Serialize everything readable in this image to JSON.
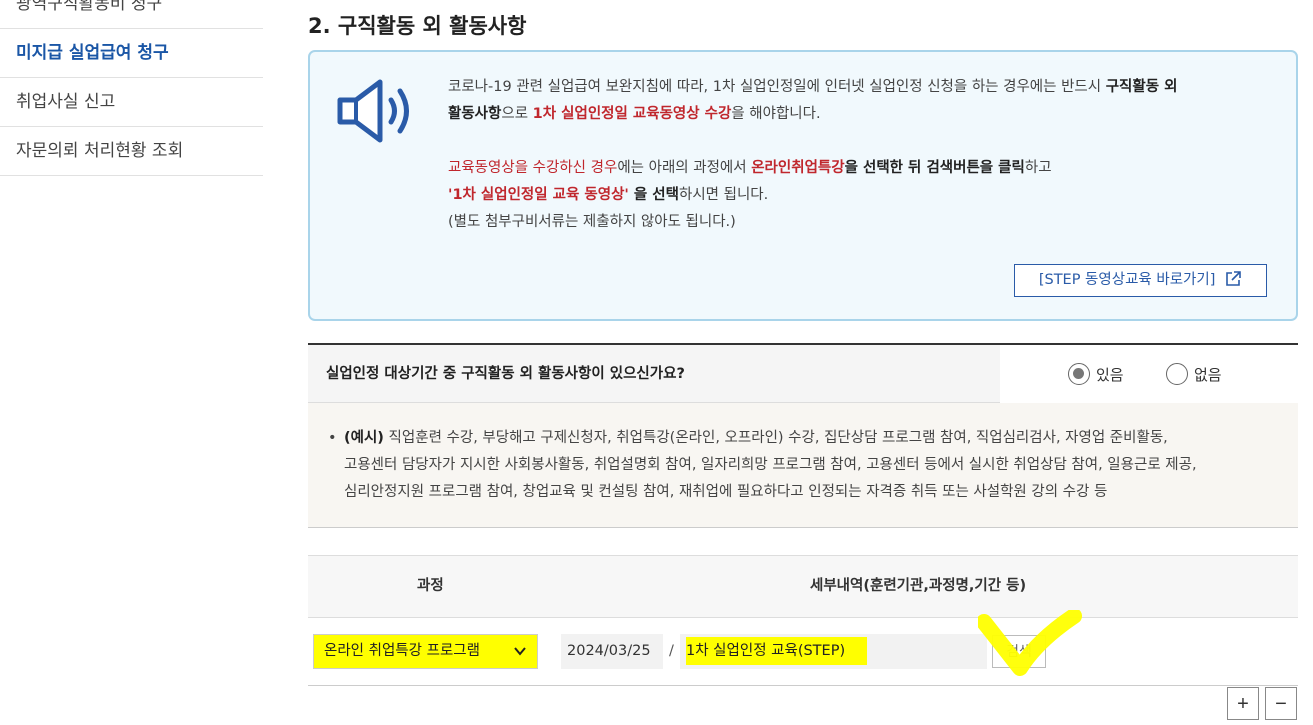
{
  "sidebar": {
    "items": [
      {
        "label": "광역구직활동비 청구"
      },
      {
        "label": "미지급 실업급여 청구"
      },
      {
        "label": "취업사실 신고"
      },
      {
        "label": "자문의뢰 처리현황 조회"
      }
    ]
  },
  "section": {
    "title": "2. 구직활동 외 활동사항"
  },
  "notice": {
    "icon": "speaker-icon",
    "line1_a": "코로나-19 관련 실업급여 보완지침에 따라, 1차 실업인정일에 인터넷 실업인정 신청을 하는 경우에는 반드시 ",
    "line1_b": "구직활동 외",
    "line2_a": "활동사항",
    "line2_b": "으로 ",
    "line2_c": "1차 실업인정일 교육동영상 수강",
    "line2_d": "을 해야합니다.",
    "line3_a": "교육동영상을 수강하신 경우",
    "line3_b": "에는 아래의 과정에서 ",
    "line3_c": "온라인취업특강",
    "line3_d": "을 선택한 뒤 검색버튼을 클릭",
    "line3_e": "하고",
    "line4_a": "'1차 실업인정일 교육 동영상'",
    "line4_b": " 을 선택",
    "line4_c": "하시면 됩니다.",
    "line5": "(별도 첨부구비서류는 제출하지 않아도 됩니다.)",
    "link_label": "[STEP 동영상교육 바로가기]"
  },
  "question": {
    "label": "실업인정 대상기간 중 구직활동 외 활동사항이 있으신가요?",
    "options": [
      {
        "label": "있음",
        "selected": true
      },
      {
        "label": "없음",
        "selected": false
      }
    ]
  },
  "examples": {
    "prefix": "(예시)",
    "line1": " 직업훈련 수강, 부당해고 구제신청자, 취업특강(온라인, 오프라인) 수강, 집단상담 프로그램 참여, 직업심리검사, 자영업 준비활동,",
    "line2": "고용센터 담당자가 지시한 사회봉사활동, 취업설명회 참여, 일자리희망 프로그램 참여, 고용센터 등에서 실시한 취업상담 참여, 일용근로 제공,",
    "line3": "심리안정지원 프로그램 참여, 창업교육 및 컨설팅 참여, 재취업에 필요하다고 인정되는 자격증 취득 또는 사설학원 강의 수강 등"
  },
  "table": {
    "headers": {
      "course": "과정",
      "detail": "세부내역(훈련기관,과정명,기간 등)"
    },
    "row": {
      "course_selected": "온라인 취업특강 프로그램",
      "date": "2024/03/25",
      "separator": "/",
      "detail": "1차 실업인정 교육(STEP)",
      "search_label": "검색"
    }
  },
  "controls": {
    "add_label": "+",
    "remove_label": "−"
  },
  "colors": {
    "accent_blue": "#1a56a6",
    "emphasis_red": "#c0272d",
    "highlight_yellow": "#ffff00",
    "notice_border": "#a9d4ea"
  }
}
